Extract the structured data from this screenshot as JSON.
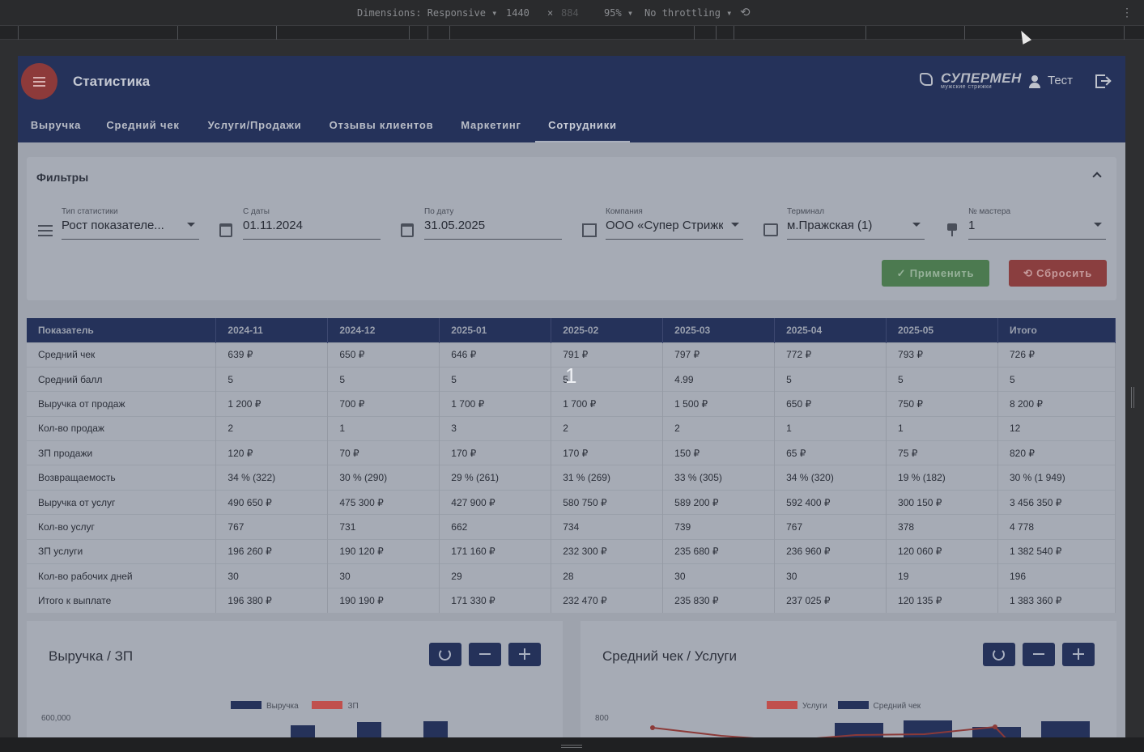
{
  "devtools": {
    "dimensions_label": "Dimensions: Responsive",
    "width": "1440",
    "times": "×",
    "height": "884",
    "zoom": "95%",
    "throttling": "No throttling"
  },
  "app": {
    "title": "Статистика",
    "logo_main": "СУПЕРМЕН",
    "logo_sub": "мужские стрижки",
    "user_name": "Тест"
  },
  "tabs": [
    {
      "label": "Выручка"
    },
    {
      "label": "Средний чек"
    },
    {
      "label": "Услуги/Продажи"
    },
    {
      "label": "Отзывы клиентов"
    },
    {
      "label": "Маркетинг"
    },
    {
      "label": "Сотрудники",
      "active": true
    }
  ],
  "filters": {
    "title": "Фильтры",
    "stat_type": {
      "label": "Тип статистики",
      "value": "Рост показателе..."
    },
    "date_from": {
      "label": "С даты",
      "value": "01.11.2024"
    },
    "date_to": {
      "label": "По дату",
      "value": "31.05.2025"
    },
    "company": {
      "label": "Компания",
      "value": "ООО «Супер Стрижк"
    },
    "terminal": {
      "label": "Терминал",
      "value": "м.Пражская (1)"
    },
    "master": {
      "label": "№ мастера",
      "value": "1"
    },
    "apply_label": "Применить",
    "reset_label": "Сбросить"
  },
  "table": {
    "headers": [
      "Показатель",
      "2024-11",
      "2024-12",
      "2025-01",
      "2025-02",
      "2025-03",
      "2025-04",
      "2025-05",
      "Итого"
    ],
    "rows": [
      [
        "Средний чек",
        "639 ₽",
        "650 ₽",
        "646 ₽",
        "791 ₽",
        "797 ₽",
        "772 ₽",
        "793 ₽",
        "726 ₽"
      ],
      [
        "Средний балл",
        "5",
        "5",
        "5",
        "5",
        "4.99",
        "5",
        "5",
        "5"
      ],
      [
        "Выручка от продаж",
        "1 200 ₽",
        "700 ₽",
        "1 700 ₽",
        "1 700 ₽",
        "1 500 ₽",
        "650 ₽",
        "750 ₽",
        "8 200 ₽"
      ],
      [
        "Кол-во продаж",
        "2",
        "1",
        "3",
        "2",
        "2",
        "1",
        "1",
        "12"
      ],
      [
        "ЗП продажи",
        "120 ₽",
        "70 ₽",
        "170 ₽",
        "170 ₽",
        "150 ₽",
        "65 ₽",
        "75 ₽",
        "820 ₽"
      ],
      [
        "Возвращаемость",
        "34 % (322)",
        "30 % (290)",
        "29 % (261)",
        "31 % (269)",
        "33 % (305)",
        "34 % (320)",
        "19 % (182)",
        "30 % (1 949)"
      ],
      [
        "Выручка от услуг",
        "490 650 ₽",
        "475 300 ₽",
        "427 900 ₽",
        "580 750 ₽",
        "589 200 ₽",
        "592 400 ₽",
        "300 150 ₽",
        "3 456 350 ₽"
      ],
      [
        "Кол-во услуг",
        "767",
        "731",
        "662",
        "734",
        "739",
        "767",
        "378",
        "4 778"
      ],
      [
        "ЗП услуги",
        "196 260 ₽",
        "190 120 ₽",
        "171 160 ₽",
        "232 300 ₽",
        "235 680 ₽",
        "236 960 ₽",
        "120 060 ₽",
        "1 382 540 ₽"
      ],
      [
        "Кол-во рабочих дней",
        "30",
        "30",
        "29",
        "28",
        "30",
        "30",
        "19",
        "196"
      ],
      [
        "Итого к выплате",
        "196 380 ₽",
        "190 190 ₽",
        "171 330 ₽",
        "232 470 ₽",
        "235 830 ₽",
        "237 025 ₽",
        "120 135 ₽",
        "1 383 360 ₽"
      ]
    ]
  },
  "overlay_number": "1",
  "charts": {
    "left": {
      "title": "Выручка / ЗП",
      "legend": [
        "Выручка",
        "ЗП"
      ],
      "ytick_top": "600,000",
      "colors": {
        "revenue": "#25325a",
        "salary": "#c0504d"
      }
    },
    "right": {
      "title": "Средний чек / Услуги",
      "legend": [
        "Услуги",
        "Средний чек"
      ],
      "ytick_top": "800",
      "colors": {
        "services": "#c0504d",
        "avg_check": "#25325a"
      }
    }
  }
}
